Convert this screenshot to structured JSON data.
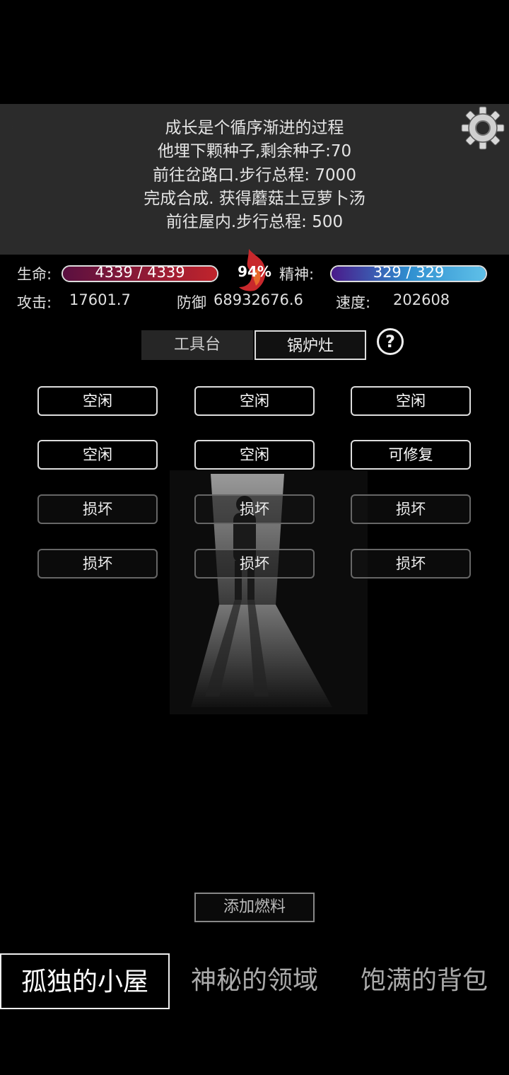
{
  "log": {
    "lines": [
      "成长是个循序渐进的过程",
      "他埋下颗种子,剩余种子:70",
      "前往岔路口.步行总程: 7000",
      "完成合成. 获得蘑菇土豆萝卜汤",
      "前往屋内.步行总程: 500"
    ]
  },
  "stats": {
    "hp_label": "生命:",
    "hp_text": "4339 / 4339",
    "hp_fraction": 1.0,
    "mood_text": "94%",
    "spirit_label": "精神:",
    "spirit_text": "329 / 329",
    "spirit_fraction": 1.0,
    "attack_label": "攻击:",
    "attack_value": "17601.7",
    "defense_label": "防御",
    "defense_value": "68932676.6",
    "speed_label": "速度:",
    "speed_value": "202608"
  },
  "tabs": {
    "workbench": "工具台",
    "stove": "锅炉灶",
    "help": "?"
  },
  "slots": [
    "空闲",
    "空闲",
    "空闲",
    "空闲",
    "空闲",
    "可修复",
    "损坏",
    "损坏",
    "损坏",
    "损坏",
    "损坏",
    "损坏"
  ],
  "fuel_button": "添加燃料",
  "nav": {
    "hut": "孤独的小屋",
    "realm": "神秘的领域",
    "backpack": "饱满的背包"
  },
  "colors": {
    "hp_bar": "#c0242c",
    "spirit_bar": "#2f8fd0",
    "panel": "#2b2b2b",
    "flame": "#c8282c"
  },
  "icons": [
    "moon-icon",
    "gear-icon",
    "flame-icon",
    "help-icon"
  ]
}
